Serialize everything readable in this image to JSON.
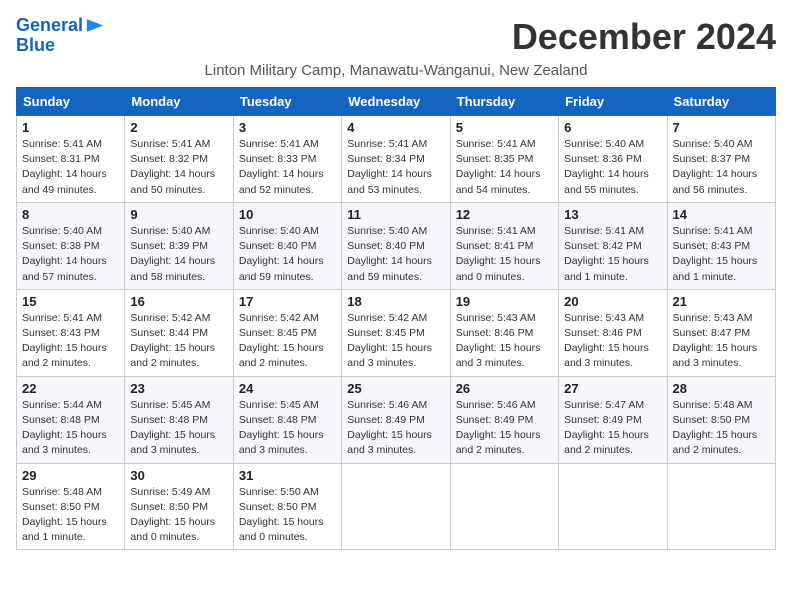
{
  "header": {
    "logo_line1": "General",
    "logo_line2": "Blue",
    "month": "December 2024",
    "location": "Linton Military Camp, Manawatu-Wanganui, New Zealand"
  },
  "days_of_week": [
    "Sunday",
    "Monday",
    "Tuesday",
    "Wednesday",
    "Thursday",
    "Friday",
    "Saturday"
  ],
  "weeks": [
    [
      {
        "day": "1",
        "info": "Sunrise: 5:41 AM\nSunset: 8:31 PM\nDaylight: 14 hours\nand 49 minutes."
      },
      {
        "day": "2",
        "info": "Sunrise: 5:41 AM\nSunset: 8:32 PM\nDaylight: 14 hours\nand 50 minutes."
      },
      {
        "day": "3",
        "info": "Sunrise: 5:41 AM\nSunset: 8:33 PM\nDaylight: 14 hours\nand 52 minutes."
      },
      {
        "day": "4",
        "info": "Sunrise: 5:41 AM\nSunset: 8:34 PM\nDaylight: 14 hours\nand 53 minutes."
      },
      {
        "day": "5",
        "info": "Sunrise: 5:41 AM\nSunset: 8:35 PM\nDaylight: 14 hours\nand 54 minutes."
      },
      {
        "day": "6",
        "info": "Sunrise: 5:40 AM\nSunset: 8:36 PM\nDaylight: 14 hours\nand 55 minutes."
      },
      {
        "day": "7",
        "info": "Sunrise: 5:40 AM\nSunset: 8:37 PM\nDaylight: 14 hours\nand 56 minutes."
      }
    ],
    [
      {
        "day": "8",
        "info": "Sunrise: 5:40 AM\nSunset: 8:38 PM\nDaylight: 14 hours\nand 57 minutes."
      },
      {
        "day": "9",
        "info": "Sunrise: 5:40 AM\nSunset: 8:39 PM\nDaylight: 14 hours\nand 58 minutes."
      },
      {
        "day": "10",
        "info": "Sunrise: 5:40 AM\nSunset: 8:40 PM\nDaylight: 14 hours\nand 59 minutes."
      },
      {
        "day": "11",
        "info": "Sunrise: 5:40 AM\nSunset: 8:40 PM\nDaylight: 14 hours\nand 59 minutes."
      },
      {
        "day": "12",
        "info": "Sunrise: 5:41 AM\nSunset: 8:41 PM\nDaylight: 15 hours\nand 0 minutes."
      },
      {
        "day": "13",
        "info": "Sunrise: 5:41 AM\nSunset: 8:42 PM\nDaylight: 15 hours\nand 1 minute."
      },
      {
        "day": "14",
        "info": "Sunrise: 5:41 AM\nSunset: 8:43 PM\nDaylight: 15 hours\nand 1 minute."
      }
    ],
    [
      {
        "day": "15",
        "info": "Sunrise: 5:41 AM\nSunset: 8:43 PM\nDaylight: 15 hours\nand 2 minutes."
      },
      {
        "day": "16",
        "info": "Sunrise: 5:42 AM\nSunset: 8:44 PM\nDaylight: 15 hours\nand 2 minutes."
      },
      {
        "day": "17",
        "info": "Sunrise: 5:42 AM\nSunset: 8:45 PM\nDaylight: 15 hours\nand 2 minutes."
      },
      {
        "day": "18",
        "info": "Sunrise: 5:42 AM\nSunset: 8:45 PM\nDaylight: 15 hours\nand 3 minutes."
      },
      {
        "day": "19",
        "info": "Sunrise: 5:43 AM\nSunset: 8:46 PM\nDaylight: 15 hours\nand 3 minutes."
      },
      {
        "day": "20",
        "info": "Sunrise: 5:43 AM\nSunset: 8:46 PM\nDaylight: 15 hours\nand 3 minutes."
      },
      {
        "day": "21",
        "info": "Sunrise: 5:43 AM\nSunset: 8:47 PM\nDaylight: 15 hours\nand 3 minutes."
      }
    ],
    [
      {
        "day": "22",
        "info": "Sunrise: 5:44 AM\nSunset: 8:48 PM\nDaylight: 15 hours\nand 3 minutes."
      },
      {
        "day": "23",
        "info": "Sunrise: 5:45 AM\nSunset: 8:48 PM\nDaylight: 15 hours\nand 3 minutes."
      },
      {
        "day": "24",
        "info": "Sunrise: 5:45 AM\nSunset: 8:48 PM\nDaylight: 15 hours\nand 3 minutes."
      },
      {
        "day": "25",
        "info": "Sunrise: 5:46 AM\nSunset: 8:49 PM\nDaylight: 15 hours\nand 3 minutes."
      },
      {
        "day": "26",
        "info": "Sunrise: 5:46 AM\nSunset: 8:49 PM\nDaylight: 15 hours\nand 2 minutes."
      },
      {
        "day": "27",
        "info": "Sunrise: 5:47 AM\nSunset: 8:49 PM\nDaylight: 15 hours\nand 2 minutes."
      },
      {
        "day": "28",
        "info": "Sunrise: 5:48 AM\nSunset: 8:50 PM\nDaylight: 15 hours\nand 2 minutes."
      }
    ],
    [
      {
        "day": "29",
        "info": "Sunrise: 5:48 AM\nSunset: 8:50 PM\nDaylight: 15 hours\nand 1 minute."
      },
      {
        "day": "30",
        "info": "Sunrise: 5:49 AM\nSunset: 8:50 PM\nDaylight: 15 hours\nand 0 minutes."
      },
      {
        "day": "31",
        "info": "Sunrise: 5:50 AM\nSunset: 8:50 PM\nDaylight: 15 hours\nand 0 minutes."
      },
      {
        "day": "",
        "info": ""
      },
      {
        "day": "",
        "info": ""
      },
      {
        "day": "",
        "info": ""
      },
      {
        "day": "",
        "info": ""
      }
    ]
  ]
}
